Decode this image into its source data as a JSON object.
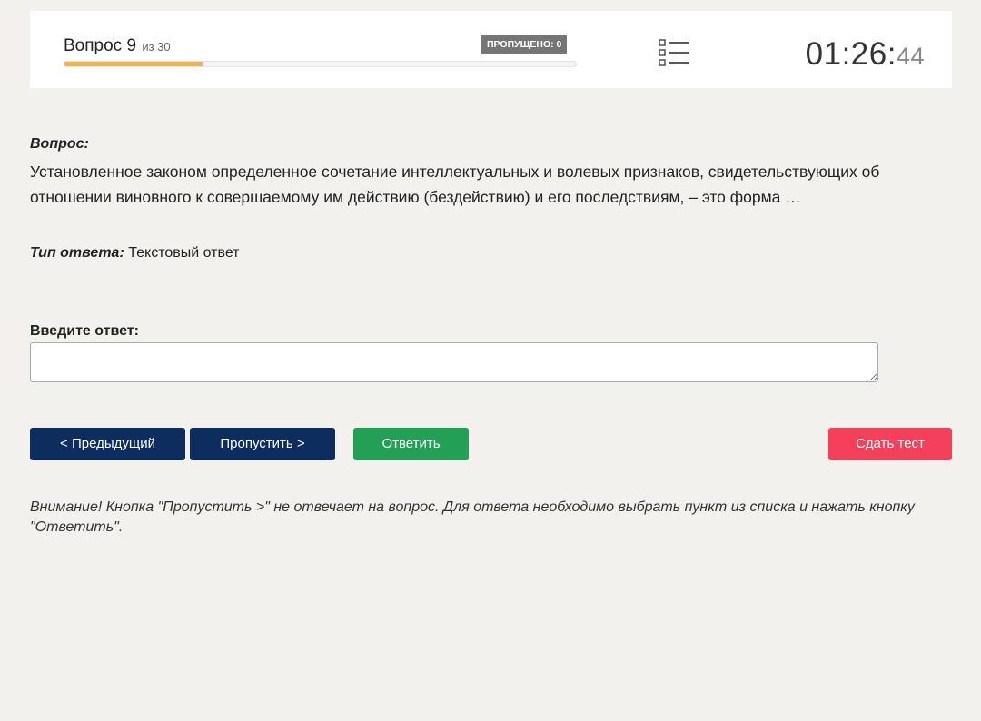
{
  "header": {
    "question_word": "Вопрос",
    "question_number": "9",
    "question_of": "из 30",
    "skipped_badge": "ПРОПУЩЕНО: 0",
    "progress_fraction": 0.27,
    "progress_color": "#f0b34a",
    "list_icon": "question-list-icon",
    "timer_main": "01:26:",
    "timer_seconds": "44"
  },
  "question": {
    "heading": "Вопрос:",
    "text": "Установленное законом определенное сочетание интеллектуальных и волевых признаков, свидетельствующих об отношении виновного к совершаемому им действию (бездействию) и его последствиям, – это форма …"
  },
  "answer_type": {
    "label": "Тип ответа:",
    "value": "Текстовый ответ"
  },
  "answer_input": {
    "label": "Введите ответ:",
    "value": ""
  },
  "buttons": {
    "prev": "< Предыдущий",
    "skip": "Пропустить >",
    "answer": "Ответить",
    "submit": "Сдать тест"
  },
  "colors": {
    "nav_button": "#0d2d5e",
    "answer_button": "#23a055",
    "submit_button": "#f4405a",
    "badge": "#757575"
  },
  "notice": "Внимание! Кнопка \"Пропустить >\" не отвечает на вопрос. Для ответа необходимо выбрать пункт из списка и нажать кнопку \"Ответить\"."
}
